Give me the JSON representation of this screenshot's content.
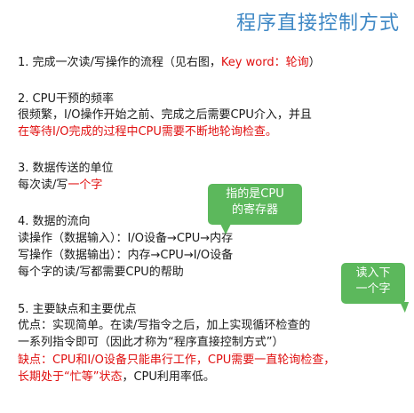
{
  "title": "程序直接控制方式",
  "s1": {
    "prefix": "1. 完成一次读/写操作的流程（见右图，",
    "keyword": "Key word：轮询",
    "suffix": "）"
  },
  "s2": {
    "heading": "2. CPU干预的频率",
    "line1": "很频繁，I/O操作开始之前、完成之后需要CPU介入，并且",
    "line2_red": "在等待I/O完成的过程中CPU需要不断地轮询检查。"
  },
  "s3": {
    "heading": "3. 数据传送的单位",
    "prefix": "每次读/写",
    "red": "一个字"
  },
  "s4": {
    "heading": "4. 数据的流向",
    "read": "读操作（数据输入）：I/O设备→CPU→内存",
    "write": "写操作（数据输出）：内存→CPU→I/O设备",
    "note": "每个字的读/写都需要CPU的帮助"
  },
  "s5": {
    "heading": "5. 主要缺点和主要优点",
    "adv1": "优点：实现简单。在读/写指令之后，加上实现循环检查的",
    "adv2": "一系列指令即可（因此才称为“程序直接控制方式”）",
    "dis1": "缺点：CPU和I/O设备只能串行工作，CPU需要一直轮询检查，",
    "dis2_red": "长期处于“忙等”状态",
    "dis2_rest": "，CPU利用率低。"
  },
  "callouts": {
    "cpu_register": [
      "指的是CPU",
      "的寄存器"
    ],
    "read_word": [
      "读入下",
      "一个字"
    ]
  },
  "colors": {
    "title": "#3f88c5",
    "highlight": "#e01010",
    "callout": "#5cb85c"
  }
}
